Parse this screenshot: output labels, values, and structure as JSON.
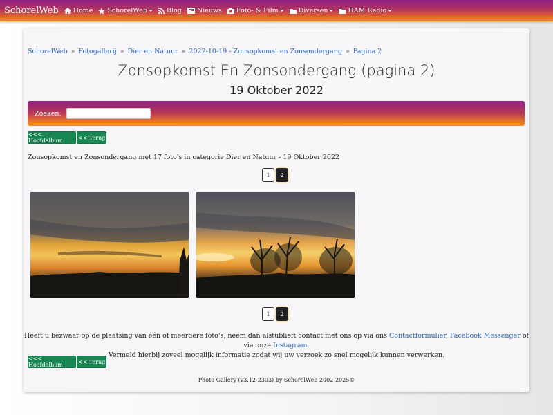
{
  "navbar": {
    "brand": "SchorelWeb",
    "items": [
      {
        "label": "Home",
        "icon": "home-icon"
      },
      {
        "label": "SchorelWeb",
        "icon": "star-icon",
        "dropdown": true
      },
      {
        "label": "Blog",
        "icon": "rss-icon"
      },
      {
        "label": "Nieuws",
        "icon": "newspaper-icon"
      },
      {
        "label": "Foto- & Film",
        "icon": "camera-icon",
        "dropdown": true
      },
      {
        "label": "Diversen",
        "icon": "folder-icon",
        "dropdown": true
      },
      {
        "label": "HAM Radio",
        "icon": "folder-icon",
        "dropdown": true
      }
    ]
  },
  "breadcrumb": [
    "SchorelWeb",
    "Fotogallerij",
    "Dier en Natuur",
    "2022-10-19 - Zonsopkomst en Zonsondergang",
    "Pagina 2"
  ],
  "breadcrumb_separator": "»",
  "page": {
    "title": "Zonsopkomst En Zonsondergang (pagina 2)",
    "subtitle": "19 Oktober 2022"
  },
  "search": {
    "label": "Zoeken:",
    "value": ""
  },
  "buttons": {
    "main_album": "<<< Hoofdalbum",
    "back": "<< Terug"
  },
  "description": "Zonsopkomst en Zonsondergang met 17 foto's in categorie Dier en Natuur - 19 Oktober 2022",
  "pagination": {
    "pages": [
      "1",
      "2"
    ],
    "current": "2"
  },
  "photos": [
    {
      "alt": "sunset-cloudy-sky-photo"
    },
    {
      "alt": "sunset-tree-silhouettes-photo"
    }
  ],
  "notice": {
    "line1_prefix": "Heeft u bezwaar op de plaatsing van één of meerdere foto's, neem dan alstublieft contact met ons op via ons ",
    "link_contact": "Contactformulier",
    "comma": ", ",
    "link_messenger": "Facebook Messenger",
    "middle": " of via onze ",
    "link_instagram": "Instagram",
    "end": ".",
    "line2": "Vermeld hierbij zoveel mogelijk informatie zodat wij uw verzoek zo snel mogelijk kunnen verwerken."
  },
  "footer": "Photo Gallery (v3.12-2303) by SchorelWeb 2002-2025©",
  "colors": {
    "accent_link": "#2a67c9",
    "button_green": "#198754",
    "nav_gradient_top": "#8e1f82",
    "nav_gradient_bottom": "#f28a1f"
  }
}
